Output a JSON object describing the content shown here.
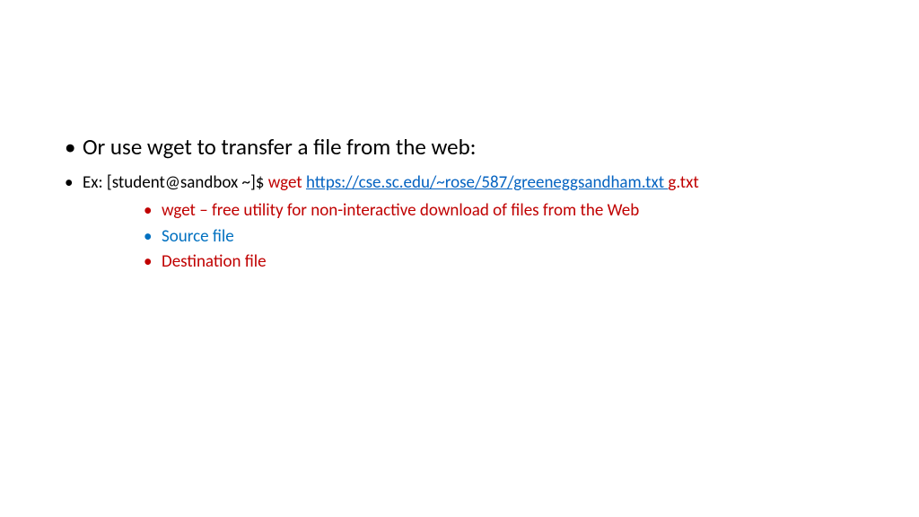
{
  "slide": {
    "bullet1": "Or use wget to transfer a file from the web:",
    "bullet2_prefix": "Ex: [student@sandbox ~]$ ",
    "bullet2_wget": "wget",
    "bullet2_url": "https://cse.sc.edu/~rose/587/greeneggsandham.txt ",
    "bullet2_dest": " g.txt",
    "bullet3_a": "wget – free utility for non-interactive download of files from the Web",
    "bullet3_b": "Source file",
    "bullet3_c": "Destination file"
  }
}
